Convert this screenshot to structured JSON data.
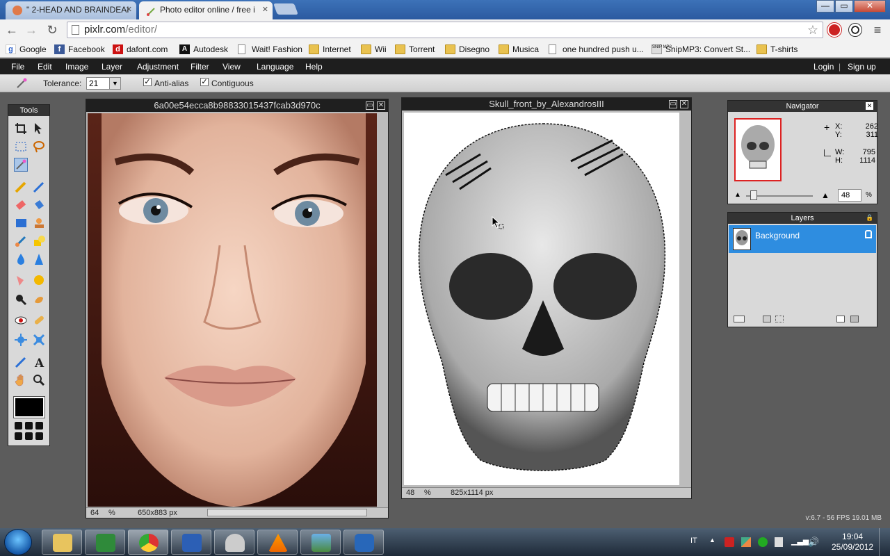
{
  "browser": {
    "tabs": [
      {
        "label": "\" 2-HEAD AND BRAINDEAI"
      },
      {
        "label": "Photo editor online / free i"
      }
    ],
    "url_host": "pixlr.com",
    "url_path": "/editor/",
    "bookmarks": [
      "Google",
      "Facebook",
      "dafont.com",
      "Autodesk",
      "Wait! Fashion",
      "Internet",
      "Wii",
      "Torrent",
      "Disegno",
      "Musica",
      "one hundred push u...",
      "SnipMP3: Convert St...",
      "T-shirts"
    ],
    "window_controls": {
      "minimize": "—",
      "maximize": "▭",
      "close": "✕"
    }
  },
  "menubar": {
    "items": [
      "File",
      "Edit",
      "Image",
      "Layer",
      "Adjustment",
      "Filter",
      "View",
      "Language",
      "Help"
    ],
    "login": "Login",
    "separator": "|",
    "signup": "Sign up"
  },
  "options": {
    "tolerance_label": "Tolerance:",
    "tolerance_value": "21",
    "antialias_label": "Anti-alias",
    "contiguous_label": "Contiguous"
  },
  "tools_panel": {
    "title": "Tools"
  },
  "windows": [
    {
      "title": "6a00e54ecca8b98833015437fcab3d970c",
      "zoom": "64",
      "zoom_unit": "%",
      "size": "650x883 px"
    },
    {
      "title": "Skull_front_by_AlexandrosIII",
      "zoom": "48",
      "zoom_unit": "%",
      "size": "825x1114 px"
    }
  ],
  "navigator": {
    "title": "Navigator",
    "x_label": "X:",
    "x_value": "262",
    "y_label": "Y:",
    "y_value": "311",
    "w_label": "W:",
    "w_value": "795",
    "h_label": "H:",
    "h_value": "1114",
    "zoom_value": "48",
    "zoom_unit": "%"
  },
  "layers": {
    "title": "Layers",
    "items": [
      {
        "name": "Background"
      }
    ]
  },
  "fps_text": "v:6.7 - 56 FPS 19.01 MB",
  "taskbar": {
    "lang": "IT",
    "time": "19:04",
    "date": "25/09/2012"
  },
  "colors": {
    "menubar": "#1e1e1e",
    "layer_selected": "#2e8de0",
    "workspace": "#5c5c5c"
  }
}
